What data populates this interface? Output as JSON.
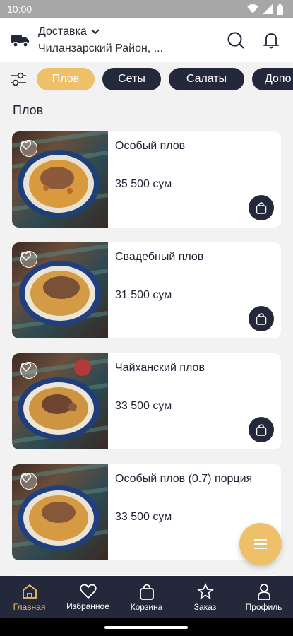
{
  "status": {
    "time": "10:00"
  },
  "header": {
    "delivery_label": "Доставка",
    "address": "Чиланзарский Район, ..."
  },
  "categories": [
    "Плов",
    "Сеты",
    "Салаты",
    "Допо"
  ],
  "section_title": "Плов",
  "products": [
    {
      "name": "Особый плов",
      "price": "35 500 сум"
    },
    {
      "name": "Свадебный плов",
      "price": "31 500 сум"
    },
    {
      "name": "Чайханский плов",
      "price": "33 500 сум"
    },
    {
      "name": "Особый плов (0.7) порция",
      "price": "33 500 сум"
    }
  ],
  "nav": {
    "home": "Главная",
    "favorites": "Избранное",
    "cart": "Корзина",
    "orders": "Заказ",
    "profile": "Профиль"
  },
  "colors": {
    "accent": "#eec06a",
    "dark": "#23283a",
    "background": "#f2f2f2"
  },
  "icons": [
    "truck-icon",
    "chevron-down-icon",
    "search-icon",
    "bell-icon",
    "filter-icon",
    "heart-icon",
    "bag-icon",
    "menu-icon",
    "home-icon",
    "star-icon",
    "person-icon"
  ]
}
